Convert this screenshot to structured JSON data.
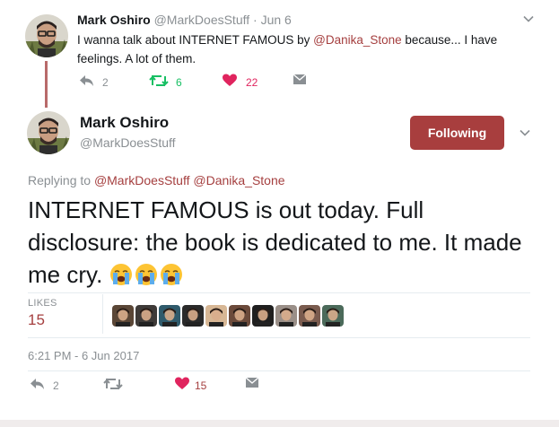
{
  "parent_tweet": {
    "name": "Mark Oshiro",
    "handle": "@MarkDoesStuff",
    "separator": "·",
    "date": "Jun 6",
    "text_before": "I wanna talk about INTERNET FAMOUS by ",
    "mention": "@Danika_Stone",
    "text_after": " because... I have feelings. A lot of them.",
    "reply_count": "2",
    "retweet_count": "6",
    "like_count": "22"
  },
  "main_tweet": {
    "name": "Mark Oshiro",
    "handle": "@MarkDoesStuff",
    "follow_label": "Following",
    "replying_label": "Replying to",
    "replying_mentions": "@MarkDoesStuff @Danika_Stone",
    "text": "INTERNET FAMOUS is out today. Full disclosure: the book is dedicated to me. It made me cry.",
    "emojis": [
      "loudly-crying-face",
      "loudly-crying-face",
      "loudly-crying-face"
    ],
    "likes_label": "LIKES",
    "likes_count": "15",
    "liker_count_shown": 10,
    "timestamp": "6:21 PM - 6 Jun 2017",
    "reply_count": "2",
    "retweet_count": "",
    "like_count": "15"
  },
  "colors": {
    "accent": "#a83e3e",
    "mention": "#a53f3f",
    "retweet": "#17bf63",
    "like": "#e0245e",
    "muted": "#8a8f93"
  }
}
